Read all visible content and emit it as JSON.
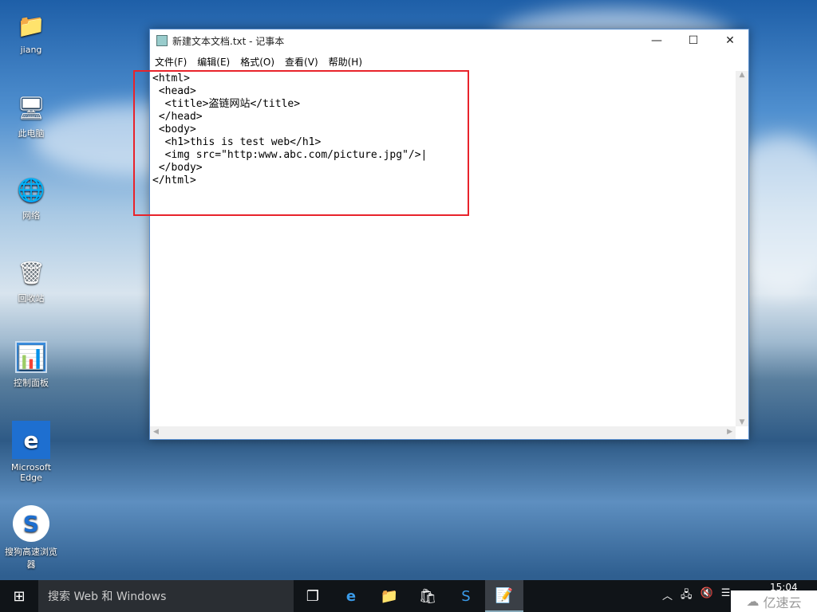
{
  "desktop": {
    "icons": [
      {
        "label": "jiang",
        "icon": "user-folder-icon"
      },
      {
        "label": "此电脑",
        "icon": "computer-icon"
      },
      {
        "label": "网络",
        "icon": "network-icon"
      },
      {
        "label": "回收站",
        "icon": "recycle-bin-icon"
      },
      {
        "label": "控制面板",
        "icon": "control-panel-icon"
      },
      {
        "label": "Microsoft Edge",
        "icon": "edge-icon"
      },
      {
        "label": "搜狗高速浏览器",
        "icon": "sogou-browser-icon"
      }
    ]
  },
  "notepad": {
    "title": "新建文本文档.txt - 记事本",
    "menu": [
      "文件(F)",
      "编辑(E)",
      "格式(O)",
      "查看(V)",
      "帮助(H)"
    ],
    "content": "<html>\n <head>\n  <title>盗链网站</title>\n </head>\n <body>\n  <h1>this is test web</h1>\n  <img src=\"http:www.abc.com/picture.jpg\"/>|\n </body>\n</html>"
  },
  "taskbar": {
    "search_placeholder": "搜索 Web 和 Windows",
    "time": "15:04"
  },
  "watermark": "亿速云",
  "colors": {
    "highlight": "#e8232b",
    "taskbar": "#101418"
  }
}
